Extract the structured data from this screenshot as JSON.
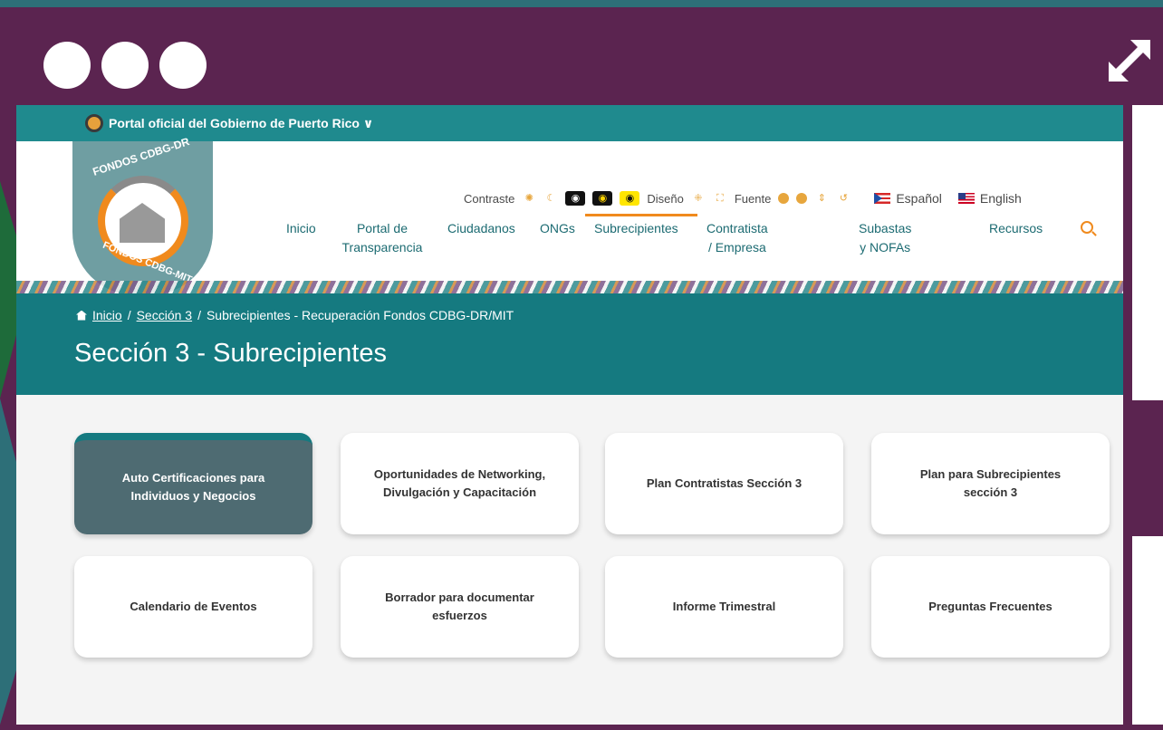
{
  "gov_bar": {
    "label": "Portal oficial del Gobierno de Puerto Rico ∨"
  },
  "logo": {
    "top_text": "FONDOS CDBG-DR",
    "bottom_text": "FONDOS CDBG-MIT"
  },
  "accessibility": {
    "contrast_label": "Contraste",
    "design_label": "Diseño",
    "font_label": "Fuente",
    "lang_es": "Español",
    "lang_en": "English"
  },
  "nav": {
    "items": [
      "Inicio",
      "Portal de Transparencia",
      "Ciudadanos",
      "ONGs",
      "Subrecipientes",
      "Contratista / Empresa",
      "Subastas y NOFAs",
      "Recursos"
    ]
  },
  "breadcrumb": {
    "home": "Inicio",
    "sep": "/",
    "section": "Sección 3",
    "current": "Subrecipientes - Recuperación Fondos CDBG-DR/MIT"
  },
  "page_title": "Sección 3 - Subrecipientes",
  "cards": [
    "Auto Certificaciones para Individuos y Negocios",
    "Oportunidades de Networking, Divulgación y Capacitación",
    "Plan Contratistas Sección 3",
    "Plan para Subrecipientes sección 3",
    "Calendario de Eventos",
    "Borrador para documentar esfuerzos",
    "Informe Trimestral",
    "Preguntas Frecuentes"
  ],
  "colors": {
    "frame": "#5b2450",
    "teal": "#157a80",
    "accent": "#f08a1d",
    "active_card": "#4e6b72"
  }
}
